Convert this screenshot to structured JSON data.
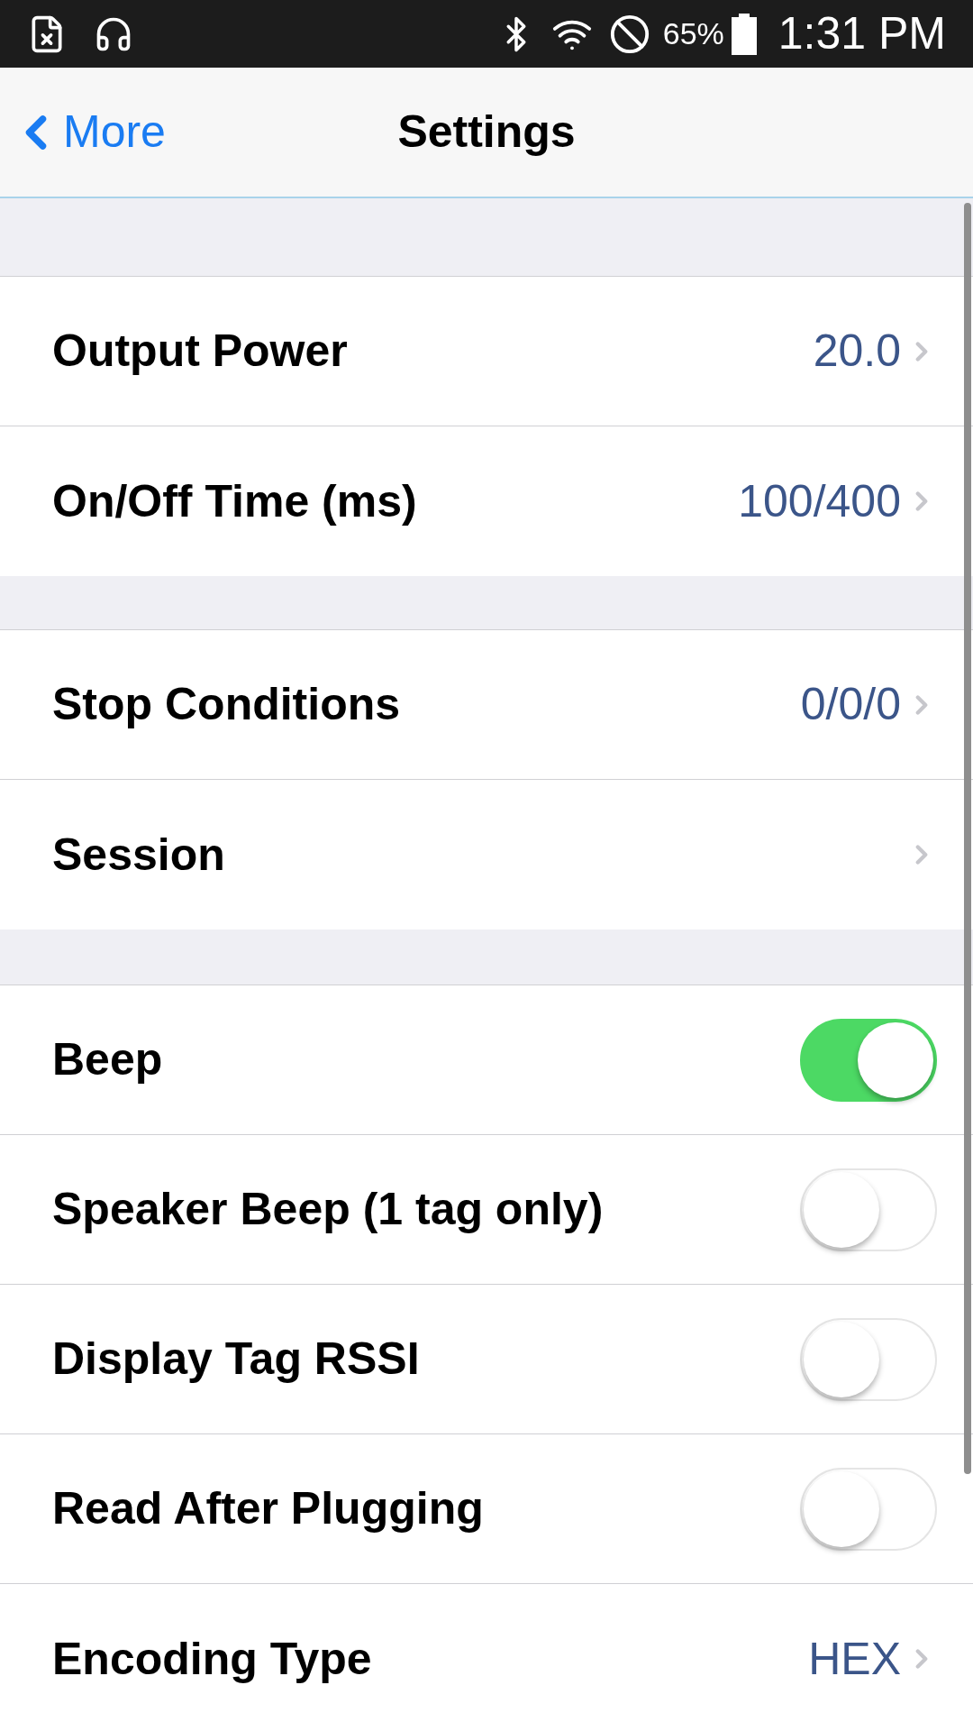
{
  "status_bar": {
    "battery": "65%",
    "time": "1:31 PM"
  },
  "nav": {
    "back": "More",
    "title": "Settings"
  },
  "sections": [
    {
      "rows": [
        {
          "kind": "value",
          "label": "Output Power",
          "value": "20.0"
        },
        {
          "kind": "value",
          "label": "On/Off Time (ms)",
          "value": "100/400"
        }
      ]
    },
    {
      "rows": [
        {
          "kind": "value",
          "label": "Stop Conditions",
          "value": "0/0/0"
        },
        {
          "kind": "link",
          "label": "Session"
        }
      ]
    },
    {
      "rows": [
        {
          "kind": "toggle",
          "label": "Beep",
          "on": true
        },
        {
          "kind": "toggle",
          "label": "Speaker Beep (1 tag only)",
          "on": false
        },
        {
          "kind": "toggle",
          "label": "Display Tag RSSI",
          "on": false
        },
        {
          "kind": "toggle",
          "label": "Read After Plugging",
          "on": false
        },
        {
          "kind": "value",
          "label": "Encoding Type",
          "value": "HEX"
        }
      ]
    }
  ]
}
